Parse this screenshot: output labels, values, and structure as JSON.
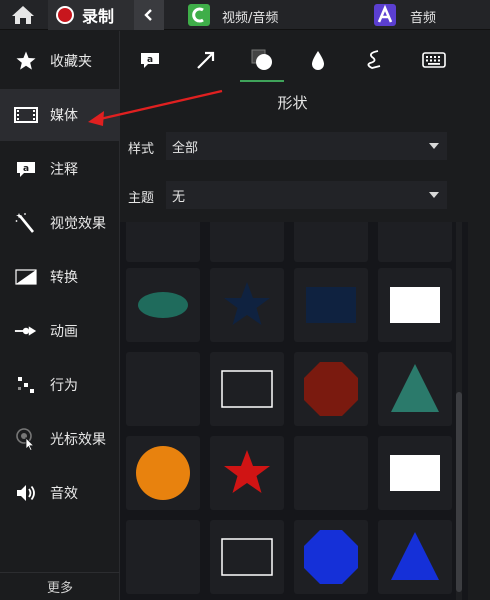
{
  "topbar": {
    "record_label": "录制",
    "video_audio_label": "视频/音频",
    "audio_label": "音频",
    "colors": {
      "record": "#c8161d",
      "camtasia_logo": "#3fae49",
      "audio_logo": "#5b3fd1"
    }
  },
  "sidebar": {
    "items": [
      {
        "label": "收藏夹",
        "icon": "star-icon"
      },
      {
        "label": "媒体",
        "icon": "film-icon",
        "active": true
      },
      {
        "label": "注释",
        "icon": "annotation-icon"
      },
      {
        "label": "视觉效果",
        "icon": "magic-wand-icon"
      },
      {
        "label": "转换",
        "icon": "transition-icon"
      },
      {
        "label": "动画",
        "icon": "animation-icon"
      },
      {
        "label": "行为",
        "icon": "behavior-icon"
      },
      {
        "label": "光标效果",
        "icon": "cursor-effect-icon"
      },
      {
        "label": "音效",
        "icon": "audio-effect-icon"
      }
    ],
    "more_label": "更多"
  },
  "tabs": [
    {
      "icon": "callout-icon"
    },
    {
      "icon": "arrow-icon"
    },
    {
      "icon": "shape-icon",
      "active": true
    },
    {
      "icon": "blur-drop-icon"
    },
    {
      "icon": "sketch-motion-icon"
    },
    {
      "icon": "keyboard-icon"
    }
  ],
  "panel": {
    "title": "形状",
    "style_label": "样式",
    "style_value": "全部",
    "theme_label": "主题",
    "theme_value": "无"
  },
  "shapes": [
    {
      "shape": "rect-outline-partial",
      "color": "#1e1f23"
    },
    {
      "shape": "rect-outline-partial",
      "color": "#ffffff"
    },
    {
      "shape": "octagon-partial",
      "color": "#0f7a4a"
    },
    {
      "shape": "trapezoid-partial",
      "color": "#3d1470"
    },
    {
      "shape": "ellipse",
      "color": "#1f6b5c"
    },
    {
      "shape": "star",
      "color": "#0f2240"
    },
    {
      "shape": "rect",
      "color": "#0f2240"
    },
    {
      "shape": "rect",
      "color": "#ffffff"
    },
    {
      "shape": "empty",
      "color": ""
    },
    {
      "shape": "rect-outline",
      "color": "#ffffff"
    },
    {
      "shape": "octagon",
      "color": "#7a1a0f"
    },
    {
      "shape": "triangle",
      "color": "#2b7a6b"
    },
    {
      "shape": "circle",
      "color": "#e8820e"
    },
    {
      "shape": "star",
      "color": "#d01414"
    },
    {
      "shape": "empty",
      "color": ""
    },
    {
      "shape": "rect",
      "color": "#ffffff"
    },
    {
      "shape": "empty",
      "color": ""
    },
    {
      "shape": "rect-outline",
      "color": "#ffffff"
    },
    {
      "shape": "octagon",
      "color": "#1530d8"
    },
    {
      "shape": "triangle",
      "color": "#1530d8"
    }
  ],
  "annotation": {
    "color": "#e02020"
  }
}
